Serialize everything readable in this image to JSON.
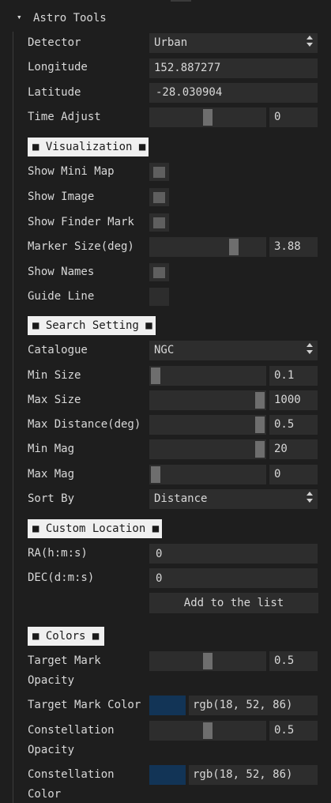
{
  "panel": {
    "title": "Astro Tools",
    "collapse_glyph": "▾"
  },
  "rows": {
    "detector": {
      "label": "Detector",
      "value": "Urban"
    },
    "longitude": {
      "label": "Longitude",
      "value": "152.887277"
    },
    "latitude": {
      "label": "Latitude",
      "value": "-28.030904"
    },
    "time_adjust": {
      "label": "Time Adjust",
      "value": "0",
      "slider_level": 0.5
    }
  },
  "visualization": {
    "header": "■ Visualization ■",
    "show_mini_map": {
      "label": "Show Mini Map",
      "checked": false
    },
    "show_image": {
      "label": "Show Image",
      "checked": false
    },
    "show_finder_mark": {
      "label": "Show Finder Mark",
      "checked": false
    },
    "marker_size": {
      "label": "Marker Size(deg)",
      "value": "3.88",
      "slider_level": 0.75
    },
    "show_names": {
      "label": "Show Names",
      "checked": false
    },
    "guide_line": {
      "label": "Guide Line",
      "checked": false
    }
  },
  "search": {
    "header": "■ Search Setting ■",
    "catalogue": {
      "label": "Catalogue",
      "value": "NGC"
    },
    "min_size": {
      "label": "Min Size",
      "value": "0.1",
      "slider_level": 0.0
    },
    "max_size": {
      "label": "Max Size",
      "value": "1000",
      "slider_level": 1.0
    },
    "max_distance": {
      "label": "Max Distance(deg)",
      "value": "0.5",
      "slider_level": 1.0
    },
    "min_mag": {
      "label": "Min Mag",
      "value": "20",
      "slider_level": 1.0
    },
    "max_mag": {
      "label": "Max Mag",
      "value": "0",
      "slider_level": 0.0
    },
    "sort_by": {
      "label": "Sort By",
      "value": "Distance"
    }
  },
  "custom_location": {
    "header": "■ Custom Location ■",
    "ra": {
      "label": "RA(h:m:s)",
      "value": "0"
    },
    "dec": {
      "label": "DEC(d:m:s)",
      "value": "0"
    },
    "add_button": "Add to the list"
  },
  "colors": {
    "header": "■ Colors ■",
    "target_mark_opacity": {
      "label_line1": "Target Mark",
      "label_line2": "Opacity",
      "value": "0.5",
      "slider_level": 0.5
    },
    "target_mark_color": {
      "label": "Target Mark Color",
      "value": "rgb(18, 52, 86)",
      "swatch": "#123456"
    },
    "constellation_opacity": {
      "label_line1": "Constellation",
      "label_line2": "Opacity",
      "value": "0.5",
      "slider_level": 0.5
    },
    "constellation_color": {
      "label_line1": "Constellation",
      "label_line2": "Color",
      "value": "rgb(18, 52, 86)",
      "swatch": "#123456"
    }
  },
  "theme": {
    "background": "#1e1e1e",
    "frame": "#2d2d2d",
    "grab": "#6e6e6e",
    "header_bg": "#f0f0f0",
    "accent_swatch": "#123456"
  }
}
